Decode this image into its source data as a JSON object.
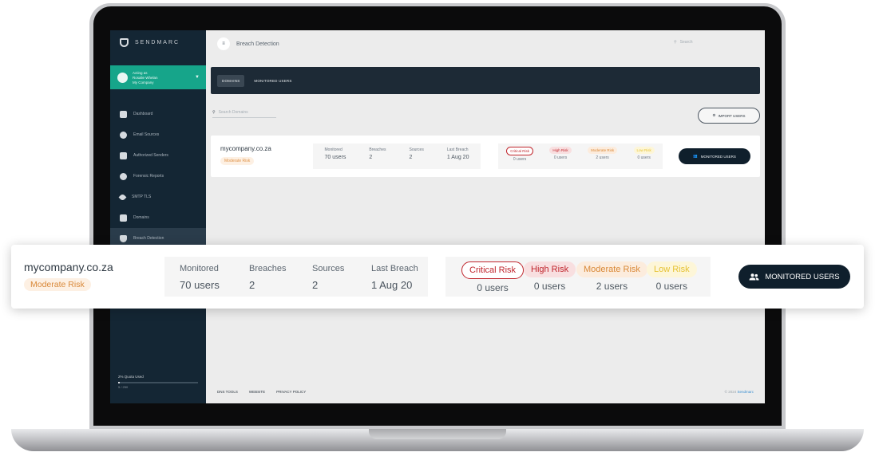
{
  "app": {
    "brand": "SENDMARC",
    "acting_as": [
      "Acting as",
      "Rosalie Whelan",
      "My Company"
    ],
    "page_title": "Breach Detection",
    "search_placeholder": "Search"
  },
  "sidebar": {
    "items": [
      {
        "label": "Dashboard",
        "icon": "dashboard-icon"
      },
      {
        "label": "Email Sources",
        "icon": "globe-icon"
      },
      {
        "label": "Authorized Senders",
        "icon": "check-square-icon"
      },
      {
        "label": "Forensic Reports",
        "icon": "alert-icon"
      },
      {
        "label": "SMTP TLS",
        "icon": "eye-icon"
      },
      {
        "label": "Domains",
        "icon": "server-icon"
      },
      {
        "label": "Breach Detection",
        "icon": "shield-icon",
        "active": true
      }
    ],
    "quota": {
      "title": "2% Quota Used",
      "sub": "5 / 250",
      "fraction": 0.02
    }
  },
  "tabs": [
    {
      "label": "DOMAINS",
      "active": true
    },
    {
      "label": "MONITORED USERS",
      "active": false
    }
  ],
  "toolbar": {
    "search_domains_placeholder": "Search Domains",
    "import_users": "IMPORT USERS"
  },
  "row": {
    "domain": "mycompany.co.za",
    "risk_badge": "Moderate Risk",
    "stats": [
      {
        "label": "Monitored",
        "value": "70 users"
      },
      {
        "label": "Breaches",
        "value": "2"
      },
      {
        "label": "Sources",
        "value": "2"
      },
      {
        "label": "Last Breach",
        "value": "1 Aug 20"
      }
    ],
    "risks": [
      {
        "label": "Critical Risk",
        "count": "0 users",
        "level": "critical"
      },
      {
        "label": "High Risk",
        "count": "0 users",
        "level": "high"
      },
      {
        "label": "Moderate Risk",
        "count": "2 users",
        "level": "moderate"
      },
      {
        "label": "Low Risk",
        "count": "0 users",
        "level": "low"
      }
    ],
    "button": "MONITORED USERS"
  },
  "footer": {
    "links": [
      "DNS TOOLS",
      "WEBSITE",
      "PRIVACY POLICY"
    ],
    "copyright": "© 2024",
    "copyright_brand": "Sendmarc"
  },
  "colors": {
    "sidebar": "#142634",
    "accent": "#16a58a",
    "button": "#0f1f2c",
    "critical": "#c0262d",
    "moderate": "#d98836",
    "low": "#e6c234"
  }
}
